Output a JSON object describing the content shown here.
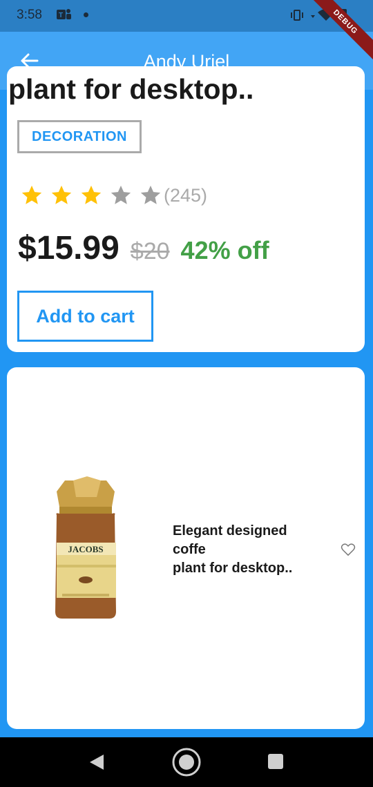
{
  "status_bar": {
    "time": "3:58",
    "icons": [
      "teams-icon",
      "dot-icon",
      "vibrate-icon",
      "wifi-icon",
      "battery-icon"
    ]
  },
  "app_bar": {
    "title": "Andy Uriel",
    "back_icon": "arrow-left-icon",
    "debug_label": "DEBUG"
  },
  "product_detail": {
    "title": "plant for desktop..",
    "category": "DECORATION",
    "rating": {
      "stars_filled": 3,
      "stars_total": 5,
      "count": "(245)"
    },
    "price": "$15.99",
    "old_price": "$20",
    "discount": "42% off",
    "add_to_cart": "Add to cart"
  },
  "product_card": {
    "line1": "Elegant designed",
    "line2": "coffe",
    "line3": "plant for desktop..",
    "image_label": "JACOBS"
  },
  "colors": {
    "primary": "#2196F3",
    "app_bar": "#42A5F5",
    "star_filled": "#FFC107",
    "star_empty": "#9E9E9E",
    "discount": "#43A047"
  }
}
